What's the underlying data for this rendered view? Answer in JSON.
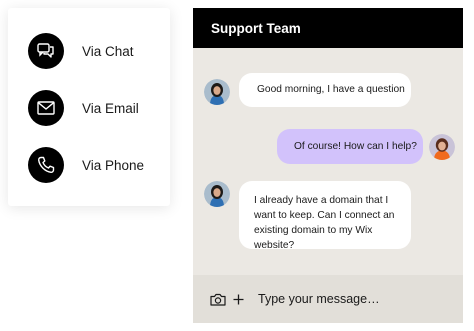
{
  "contact_options": [
    {
      "label": "Via Chat",
      "icon": "chat-icon"
    },
    {
      "label": "Via Email",
      "icon": "email-icon"
    },
    {
      "label": "Via Phone",
      "icon": "phone-icon"
    }
  ],
  "chat": {
    "title": "Support Team",
    "messages": [
      {
        "sender": "agent",
        "text": "Good morning, I have a question"
      },
      {
        "sender": "user",
        "text": "Of course! How can I help?"
      },
      {
        "sender": "agent",
        "text": "I already have a domain that I want to keep. Can I connect an existing domain to my Wix website?"
      }
    ],
    "composer": {
      "placeholder": "Type your message…"
    }
  },
  "colors": {
    "header_bg": "#000000",
    "panel_bg": "#ebe8e3",
    "user_bubble": "#d2c2fb",
    "agent_bubble": "#ffffff"
  }
}
